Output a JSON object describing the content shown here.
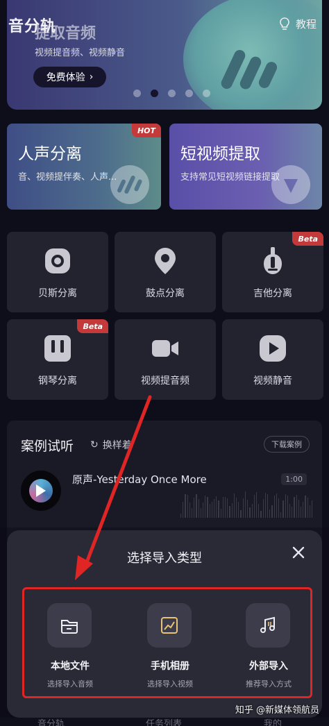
{
  "app": {
    "title": "音分轨",
    "tutorial_label": "教程"
  },
  "banner": {
    "title": "提取音频",
    "subtitle": "视频提音频、视频静音",
    "button_label": "免费体验",
    "button_chevron": "›",
    "page_count": 5,
    "active_page": 2
  },
  "feature_cards": [
    {
      "title": "人声分离",
      "subtitle": "音、视频提伴奏、人声...",
      "badge": "HOT"
    },
    {
      "title": "短视频提取",
      "subtitle": "支持常见短视频链接提取",
      "badge": ""
    }
  ],
  "tools": [
    {
      "label": "贝斯分离",
      "icon": "bass-speaker-icon",
      "badge": ""
    },
    {
      "label": "鼓点分离",
      "icon": "drum-pin-icon",
      "badge": ""
    },
    {
      "label": "吉他分离",
      "icon": "guitar-icon",
      "badge": "Beta"
    },
    {
      "label": "钢琴分离",
      "icon": "piano-icon",
      "badge": "Beta"
    },
    {
      "label": "视频提音频",
      "icon": "video-camera-icon",
      "badge": ""
    },
    {
      "label": "视频静音",
      "icon": "play-icon",
      "badge": ""
    }
  ],
  "case_section": {
    "title": "案例试听",
    "refresh_label": "换样着",
    "download_label": "下载案例",
    "track_name": "原声-Yesterday Once More",
    "track_time": "1:00"
  },
  "import_sheet": {
    "title": "选择导入类型",
    "options": [
      {
        "name": "本地文件",
        "subtitle": "选择导入音频",
        "icon": "folder-icon"
      },
      {
        "name": "手机相册",
        "subtitle": "选择导入视频",
        "icon": "photo-album-icon"
      },
      {
        "name": "外部导入",
        "subtitle": "推荐导入方式",
        "icon": "music-note-icon"
      }
    ]
  },
  "bottom_nav": {
    "items": [
      "音分轨",
      "任务列表",
      "我的"
    ]
  },
  "watermark": "知乎 @新媒体领航员",
  "colors": {
    "highlight": "#e02525",
    "badge": "#c43a3a",
    "background": "#0e0d1a"
  }
}
